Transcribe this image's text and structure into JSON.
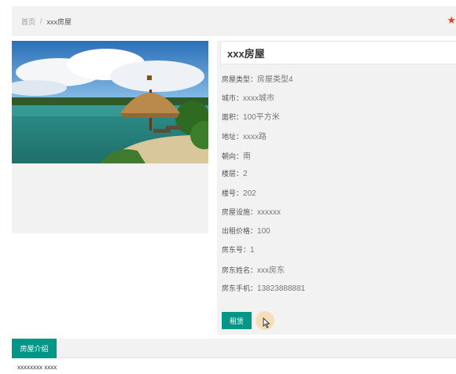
{
  "breadcrumb": {
    "home": "首页",
    "separator": "/",
    "current": "xxx房屋"
  },
  "house": {
    "title": "xxx房屋",
    "details": [
      {
        "label": "房屋类型：",
        "value": "房屋类型4"
      },
      {
        "label": "城市：",
        "value": "xxxx城市"
      },
      {
        "label": "面积：",
        "value": "100平方米"
      },
      {
        "label": "地址：",
        "value": "xxxx路"
      },
      {
        "label": "朝向：",
        "value": "南"
      },
      {
        "label": "楼层：",
        "value": "2"
      },
      {
        "label": "楼号：",
        "value": "202"
      },
      {
        "label": "房屋设施：",
        "value": "xxxxxx"
      },
      {
        "label": "出租价格：",
        "value": "100"
      },
      {
        "label": "房东号：",
        "value": "1"
      },
      {
        "label": "房东姓名：",
        "value": "xxx房东"
      },
      {
        "label": "房东手机：",
        "value": "13823888881"
      }
    ],
    "rent_button": "租赁"
  },
  "tabs": {
    "intro_label": "房屋介绍"
  },
  "intro": {
    "text": "xxxxxxxx xxxx"
  },
  "colors": {
    "accent": "#009688",
    "star": "#e8411f",
    "panel_bg": "#f2f2f2"
  },
  "icons": {
    "favorite": "star-icon",
    "cursor": "cursor-icon"
  }
}
